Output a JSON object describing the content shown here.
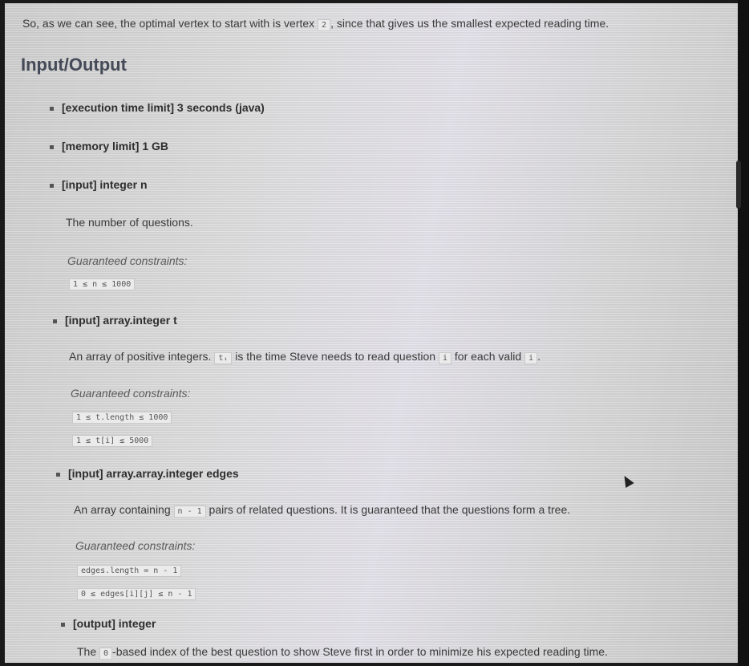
{
  "intro": {
    "before": "So, as we can see, the optimal vertex to start with is vertex ",
    "code": "2",
    "after": ", since that gives us the smallest expected reading time."
  },
  "section_title": "Input/Output",
  "bullets": {
    "time_limit": "[execution time limit] 3 seconds (java)",
    "memory_limit": "[memory limit] 1 GB",
    "input_n": "[input] integer n",
    "input_t": "[input] array.integer t",
    "input_edges": "[input] array.array.integer edges",
    "output": "[output] integer"
  },
  "n_desc": "The number of questions.",
  "guaranteed_label": "Guaranteed constraints:",
  "n_constraint": "1 ≤ n ≤ 1000",
  "t_desc": {
    "before": "An array of positive integers. ",
    "code1": "tᵢ",
    "middle": " is the time Steve needs to read question ",
    "code2": "i",
    "middle2": " for each valid ",
    "code3": "i",
    "after": "."
  },
  "t_constraints": [
    "1 ≤ t.length ≤ 1000",
    "1 ≤ t[i] ≤ 5000"
  ],
  "edges_desc": {
    "before": "An array containing ",
    "code": "n - 1",
    "after": " pairs of related questions. It is guaranteed that the questions form a tree."
  },
  "edges_constraints": [
    "edges.length = n - 1",
    "0 ≤ edges[i][j] ≤ n - 1"
  ],
  "output_desc": {
    "before": "The ",
    "code": "0",
    "after": "-based index of the best question to show Steve first in order to minimize his expected reading time."
  }
}
